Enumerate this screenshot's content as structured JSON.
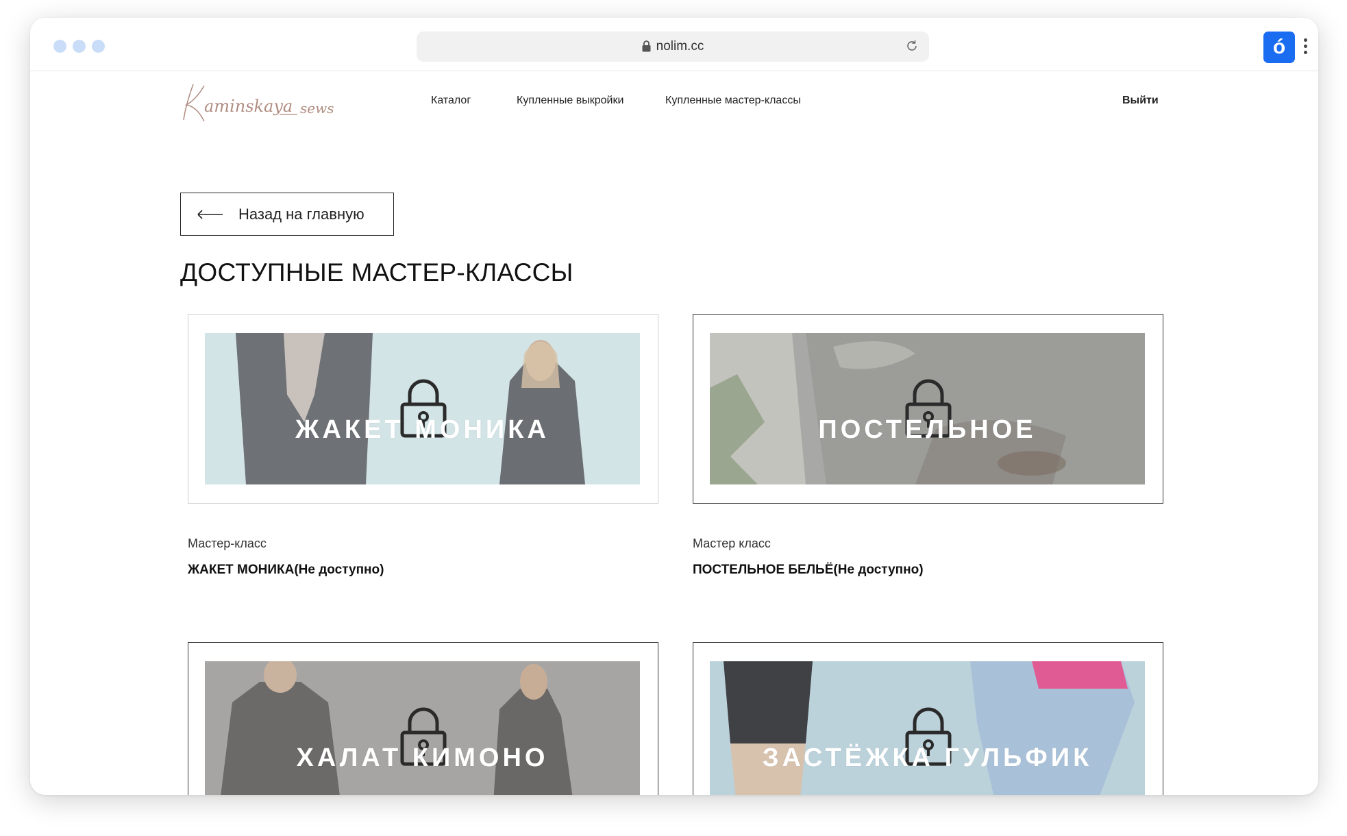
{
  "browser": {
    "url": "nolim.cc",
    "extension_label": "ó",
    "icons": {
      "lock": "lock-icon",
      "reload": "reload-icon",
      "menu": "more-vertical-icon"
    }
  },
  "site": {
    "logo_text": "Kaminskaya sews",
    "nav": {
      "catalog": "Каталог",
      "purchased_patterns": "Купленные выкройки",
      "purchased_masterclasses": "Купленные мастер-классы",
      "logout": "Выйти"
    }
  },
  "main": {
    "back_button": "Назад на главную",
    "section_title": "ДОСТУПНЫЕ МАСТЕР-КЛАССЫ",
    "cards": [
      {
        "overlay": "ЖАКЕТ МОНИКА",
        "label": "Мастер-класс",
        "title": "ЖАКЕТ МОНИКА(Не доступно)",
        "locked": true
      },
      {
        "overlay": "ПОСТЕЛЬНОЕ",
        "label": "Мастер класс",
        "title": "ПОСТЕЛЬНОЕ БЕЛЬЁ(Не доступно)",
        "locked": true
      },
      {
        "overlay": "ХАЛАТ КИМОНО",
        "label": "",
        "title": "",
        "locked": true
      },
      {
        "overlay": "ЗАСТЁЖКА ГУЛЬФИК",
        "label": "",
        "title": "",
        "locked": true
      }
    ]
  },
  "colors": {
    "accent": "#1a6cf0",
    "logo": "#b08c80",
    "text": "#111111",
    "card_border": "#cfcfcf"
  }
}
